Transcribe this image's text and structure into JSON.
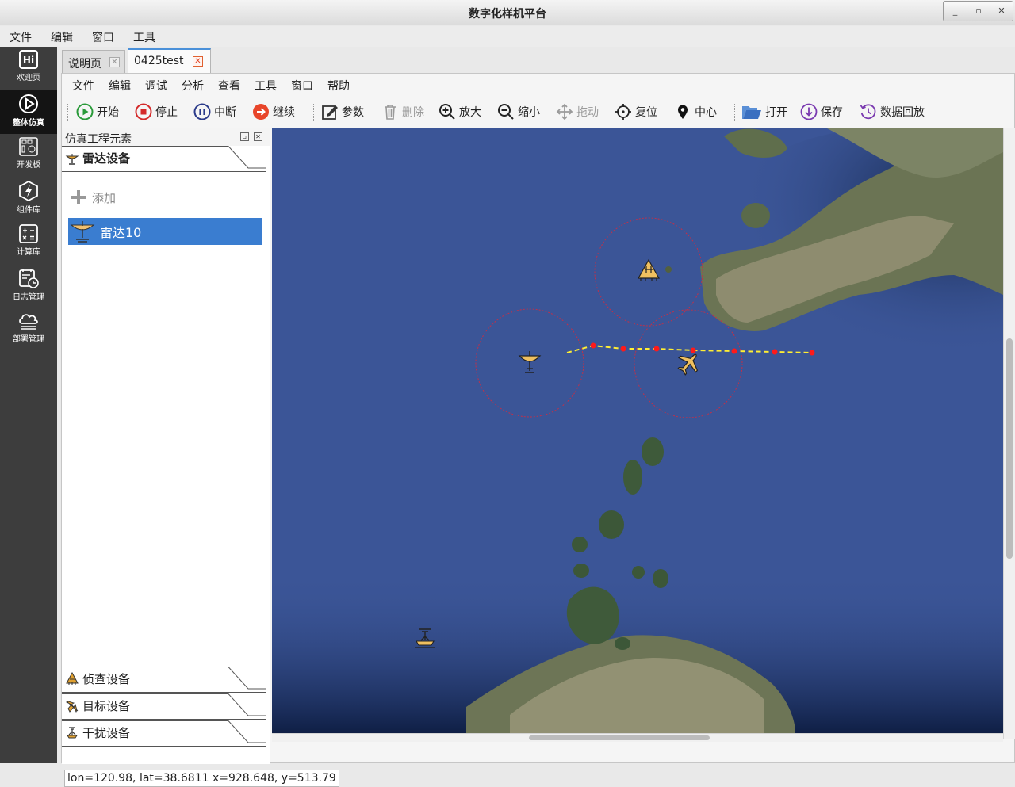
{
  "window": {
    "title": "数字化样机平台"
  },
  "main_menu": [
    "文件",
    "编辑",
    "窗口",
    "工具"
  ],
  "left_nav": [
    {
      "label": "欢迎页",
      "icon": "hi-icon"
    },
    {
      "label": "整体仿真",
      "icon": "play-circle-icon",
      "active": true
    },
    {
      "label": "开发板",
      "icon": "board-icon"
    },
    {
      "label": "组件库",
      "icon": "lightning-hex-icon"
    },
    {
      "label": "计算库",
      "icon": "calculator-icon"
    },
    {
      "label": "日志管理",
      "icon": "log-clock-icon"
    },
    {
      "label": "部署管理",
      "icon": "cloud-icon"
    }
  ],
  "doc_tabs": [
    {
      "label": "说明页",
      "active": false
    },
    {
      "label": "0425test",
      "active": true
    }
  ],
  "sub_menu": [
    "文件",
    "编辑",
    "调试",
    "分析",
    "查看",
    "工具",
    "窗口",
    "帮助"
  ],
  "toolbar": {
    "start": "开始",
    "stop": "停止",
    "pause": "中断",
    "resume": "继续",
    "params": "参数",
    "delete": "删除",
    "zoom_in": "放大",
    "zoom_out": "缩小",
    "drag": "拖动",
    "reset": "复位",
    "center": "中心",
    "open": "打开",
    "save": "保存",
    "playback": "数据回放"
  },
  "tree": {
    "title": "仿真工程元素",
    "radar_section": "雷达设备",
    "add": "添加",
    "radar_item": "雷达10",
    "recon_section": "侦查设备",
    "target_section": "目标设备",
    "jammer_section": "干扰设备"
  },
  "status_text": "lon=120.98, lat=38.6811 x=928.648, y=513.79",
  "colors": {
    "accent": "#3a7dd0",
    "nav_bg": "#3d3d3d",
    "sea": "#3b5597",
    "route": "#ffee33",
    "waypoint": "#ff1a1a",
    "radar_ring": "#c0304a"
  }
}
